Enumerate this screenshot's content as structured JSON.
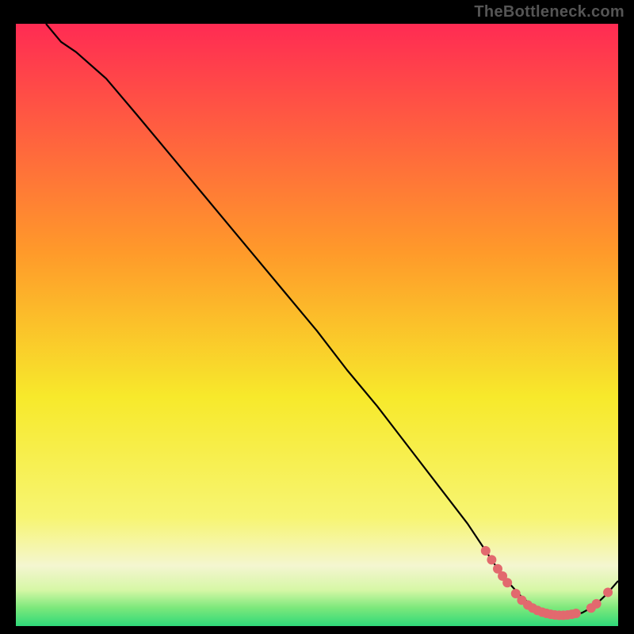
{
  "watermark": "TheBottleneck.com",
  "colors": {
    "background": "#000000",
    "curve": "#000000",
    "dot": "#e2696e",
    "dot_stroke": "#e2696e",
    "grad_top": "#ff2b53",
    "grad_upper_mid": "#ff9a2a",
    "grad_mid": "#f7e92b",
    "grad_lower_yellow": "#f7f572",
    "grad_pale": "#f4f6d0",
    "grad_green1": "#d6f7a6",
    "grad_green2": "#7be87b",
    "grad_bottom": "#2fd97a"
  },
  "chart_data": {
    "type": "line",
    "title": "",
    "xlabel": "",
    "ylabel": "",
    "xlim": [
      0,
      100
    ],
    "ylim": [
      0,
      100
    ],
    "series": [
      {
        "name": "curve",
        "x": [
          5,
          7.5,
          10,
          15,
          20,
          25,
          30,
          35,
          40,
          45,
          50,
          55,
          60,
          65,
          70,
          75,
          78,
          80,
          82,
          84,
          86,
          88,
          90,
          92,
          94,
          96,
          98,
          100
        ],
        "y": [
          100,
          97,
          95.3,
          90.9,
          85,
          79,
          73,
          67,
          61,
          55,
          49,
          42.5,
          36.5,
          30,
          23.5,
          17,
          12.5,
          9.5,
          7,
          4.8,
          3.2,
          2.2,
          1.8,
          1.8,
          2.2,
          3.3,
          5.2,
          7.5
        ]
      }
    ],
    "dots": {
      "name": "highlight-dots",
      "points": [
        {
          "x": 78,
          "y": 12.5
        },
        {
          "x": 79,
          "y": 11.0
        },
        {
          "x": 80,
          "y": 9.5
        },
        {
          "x": 80.8,
          "y": 8.3
        },
        {
          "x": 81.6,
          "y": 7.2
        },
        {
          "x": 83,
          "y": 5.4
        },
        {
          "x": 84,
          "y": 4.3
        },
        {
          "x": 85,
          "y": 3.5
        },
        {
          "x": 85.8,
          "y": 3.0
        },
        {
          "x": 86.6,
          "y": 2.6
        },
        {
          "x": 87.4,
          "y": 2.3
        },
        {
          "x": 88.1,
          "y": 2.1
        },
        {
          "x": 88.8,
          "y": 1.95
        },
        {
          "x": 89.5,
          "y": 1.85
        },
        {
          "x": 90.2,
          "y": 1.8
        },
        {
          "x": 90.9,
          "y": 1.8
        },
        {
          "x": 91.6,
          "y": 1.85
        },
        {
          "x": 92.3,
          "y": 1.95
        },
        {
          "x": 93.0,
          "y": 2.1
        },
        {
          "x": 95.5,
          "y": 3.0
        },
        {
          "x": 96.4,
          "y": 3.7
        },
        {
          "x": 98.3,
          "y": 5.6
        }
      ]
    }
  }
}
